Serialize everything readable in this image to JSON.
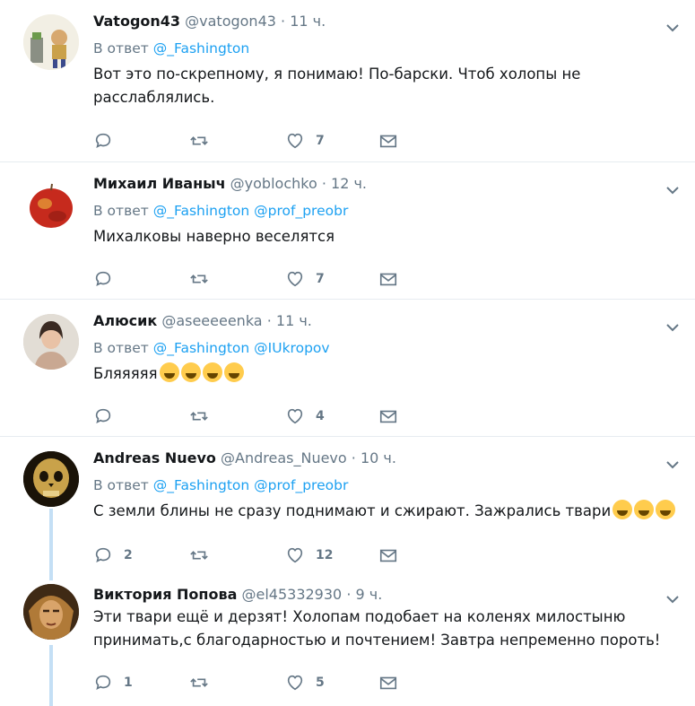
{
  "tweets": [
    {
      "fullname": "Vatogon43",
      "username": "@vatogon43",
      "dot": "·",
      "time": "11 ч.",
      "reply_label": "В ответ",
      "reply_to": [
        "@_Fashington"
      ],
      "text": "Вот это по-скрепному, я понимаю! По-барски. Чтоб холопы не расслаблялись.",
      "emojis": [],
      "replies": "",
      "retweets": "",
      "likes": "7"
    },
    {
      "fullname": "Михаил Иваныч",
      "username": "@yoblochko",
      "dot": "·",
      "time": "12 ч.",
      "reply_label": "В ответ",
      "reply_to": [
        "@_Fashington",
        "@prof_preobr"
      ],
      "text": "Михалковы наверно веселятся",
      "emojis": [],
      "replies": "",
      "retweets": "",
      "likes": "7"
    },
    {
      "fullname": "Алюсик",
      "username": "@aseeeeenka",
      "dot": "·",
      "time": "11 ч.",
      "reply_label": "В ответ",
      "reply_to": [
        "@_Fashington",
        "@IUkropov"
      ],
      "text": "Бляяяяя",
      "emojis": [
        "face-with-tears-of-joy-emoji",
        "face-with-tears-of-joy-emoji",
        "face-with-tears-of-joy-emoji",
        "face-with-tears-of-joy-emoji"
      ],
      "replies": "",
      "retweets": "",
      "likes": "4"
    },
    {
      "fullname": "Andreas Nuevo",
      "username": "@Andreas_Nuevo",
      "dot": "·",
      "time": "10 ч.",
      "reply_label": "В ответ",
      "reply_to": [
        "@_Fashington",
        "@prof_preobr"
      ],
      "text": "С земли блины не сразу поднимают и  сжирают. Зажрались твари",
      "emojis": [
        "grinning-face-emoji",
        "grinning-face-emoji",
        "grinning-face-emoji"
      ],
      "replies": "2",
      "retweets": "",
      "likes": "12"
    },
    {
      "fullname": "Виктория Попова",
      "username": "@el45332930",
      "dot": "·",
      "time": "9 ч.",
      "reply_label": "",
      "reply_to": [],
      "text": "Эти твари ещё и дерзят! Холопам подобает на коленях милостыню принимать,с благодарностью и почтением! Завтра непременно пороть!",
      "emojis": [],
      "replies": "1",
      "retweets": "",
      "likes": "5"
    }
  ],
  "icons": {
    "reply": "reply-icon",
    "retweet": "retweet-icon",
    "like": "heart-icon",
    "dm": "envelope-icon",
    "more": "chevron-down-icon"
  },
  "colors": {
    "link": "#1da1f2",
    "muted": "#657786",
    "thread_line": "#c4dff5",
    "border": "#e6ecf0"
  }
}
